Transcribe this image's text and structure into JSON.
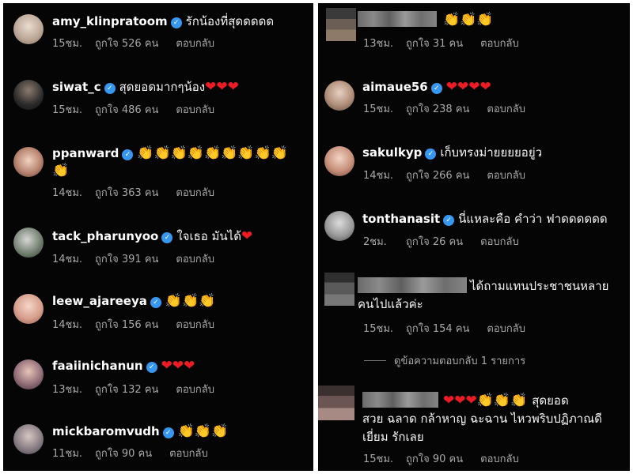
{
  "labels": {
    "like_prefix": "ถูกใจ",
    "like_suffix": "คน",
    "reply": "ตอบกลับ"
  },
  "left_comments": [
    {
      "username": "amy_klinpratoom",
      "verified": true,
      "text": "รักน้องที่สุดดดดด",
      "time": "15ชม.",
      "likes": "526"
    },
    {
      "username": "siwat_c",
      "verified": true,
      "text": "สุดยอดมากๆน้อง",
      "hearts": "❤❤❤",
      "time": "15ชม.",
      "likes": "486"
    },
    {
      "username": "ppanward",
      "verified": true,
      "emoji": "👏👏👏👏👏👏👏👏👏",
      "emoji2": "👏",
      "time": "14ชม.",
      "likes": "363"
    },
    {
      "username": "tack_pharunyoo",
      "verified": true,
      "text": "ใจเธอ มันได้",
      "hearts": "❤",
      "time": "14ชม.",
      "likes": "391"
    },
    {
      "username": "leew_ajareeya",
      "verified": true,
      "emoji": "👏👏👏",
      "time": "14ชม.",
      "likes": "156"
    },
    {
      "username": "faaiinichanun",
      "verified": true,
      "hearts": "❤❤❤",
      "time": "13ชม.",
      "likes": "132"
    },
    {
      "username": "mickbaromvudh",
      "verified": true,
      "emoji": "👏👏👏",
      "time": "11ชม.",
      "likes": "90"
    }
  ],
  "right_comments": [
    {
      "username": "",
      "emoji": "👏👏👏",
      "time": "13ชม.",
      "likes": "31"
    },
    {
      "username": "aimaue56",
      "verified": true,
      "hearts": "❤❤❤❤",
      "time": "15ชม.",
      "likes": "238"
    },
    {
      "username": "sakulkyp",
      "verified": true,
      "text": "เก็บทรงม่ายยยยอยู่ว",
      "time": "14ชม.",
      "likes": "266"
    },
    {
      "username": "tonthanasit",
      "verified": true,
      "text": "นี่แหละคือ คำว่า ฟาดดดดดด",
      "time": "2ชม.",
      "likes": "26"
    },
    {
      "username": "",
      "text": "ได้ถามแทนประชาชนหลาย",
      "text2": "คนไปแล้วค่ะ",
      "time": "15ชม.",
      "likes": "154"
    },
    {
      "username": "",
      "hearts": "❤❤❤",
      "emoji": "👏👏👏",
      "text": "สุดยอด",
      "text2": "สวย ฉลาด กล้าหาญ ฉะฉาน ไหวพริบปฏิภาณดี",
      "text3": "เยี่ยม รักเลย",
      "time": "15ชม.",
      "likes": "90"
    }
  ],
  "view_replies": "ดูข้อความตอบกลับ 1 รายการ",
  "colors": {
    "background": "#050505",
    "text": "#f5f5f5",
    "meta": "#a8a8a8",
    "verified": "#3797f0",
    "heart": "#ed1c24",
    "clap": "#ffb400"
  }
}
